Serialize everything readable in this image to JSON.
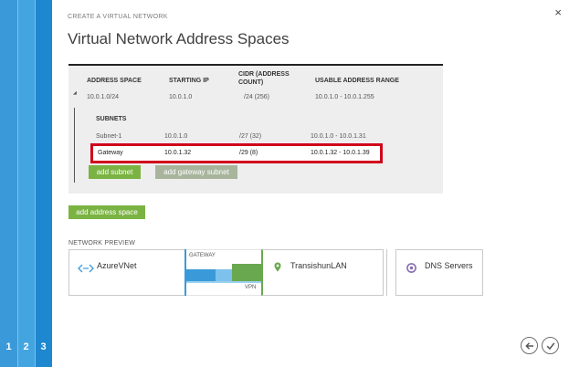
{
  "wizard": {
    "steps": [
      "1",
      "2",
      "3"
    ],
    "subtitle": "CREATE A VIRTUAL NETWORK",
    "title": "Virtual Network Address Spaces",
    "close_glyph": "×"
  },
  "address_table": {
    "headers": {
      "address_space": "ADDRESS SPACE",
      "starting_ip": "STARTING IP",
      "cidr_line1": "CIDR (ADDRESS",
      "cidr_line2": "COUNT)",
      "usable_range": "USABLE ADDRESS RANGE"
    },
    "row": {
      "address_space": "10.0.1.0/24",
      "starting_ip": "10.0.1.0",
      "cidr": "/24 (256)",
      "usable_range": "10.0.1.0 - 10.0.1.255"
    },
    "subnets_label": "SUBNETS",
    "subnets": [
      {
        "name": "Subnet-1",
        "starting_ip": "10.0.1.0",
        "cidr": "/27 (32)",
        "usable_range": "10.0.1.0 - 10.0.1.31"
      },
      {
        "name": "Gateway",
        "starting_ip": "10.0.1.32",
        "cidr": "/29 (8)",
        "usable_range": "10.0.1.32 - 10.0.1.39"
      }
    ],
    "add_subnet_label": "add subnet",
    "add_gateway_subnet_label": "add gateway subnet"
  },
  "add_address_space_label": "add address space",
  "network_preview": {
    "label": "NETWORK PREVIEW",
    "vnet_name": "AzureVNet",
    "gateway_label": "GATEWAY",
    "vpn_label": "VPN",
    "local_network_name": "TransishunLAN",
    "dns_label": "DNS Servers"
  },
  "colors": {
    "accent_blue": "#1d87cf",
    "button_green": "#7bb342",
    "highlight_red": "#d0021b",
    "gateway_green": "#6aa84f"
  }
}
